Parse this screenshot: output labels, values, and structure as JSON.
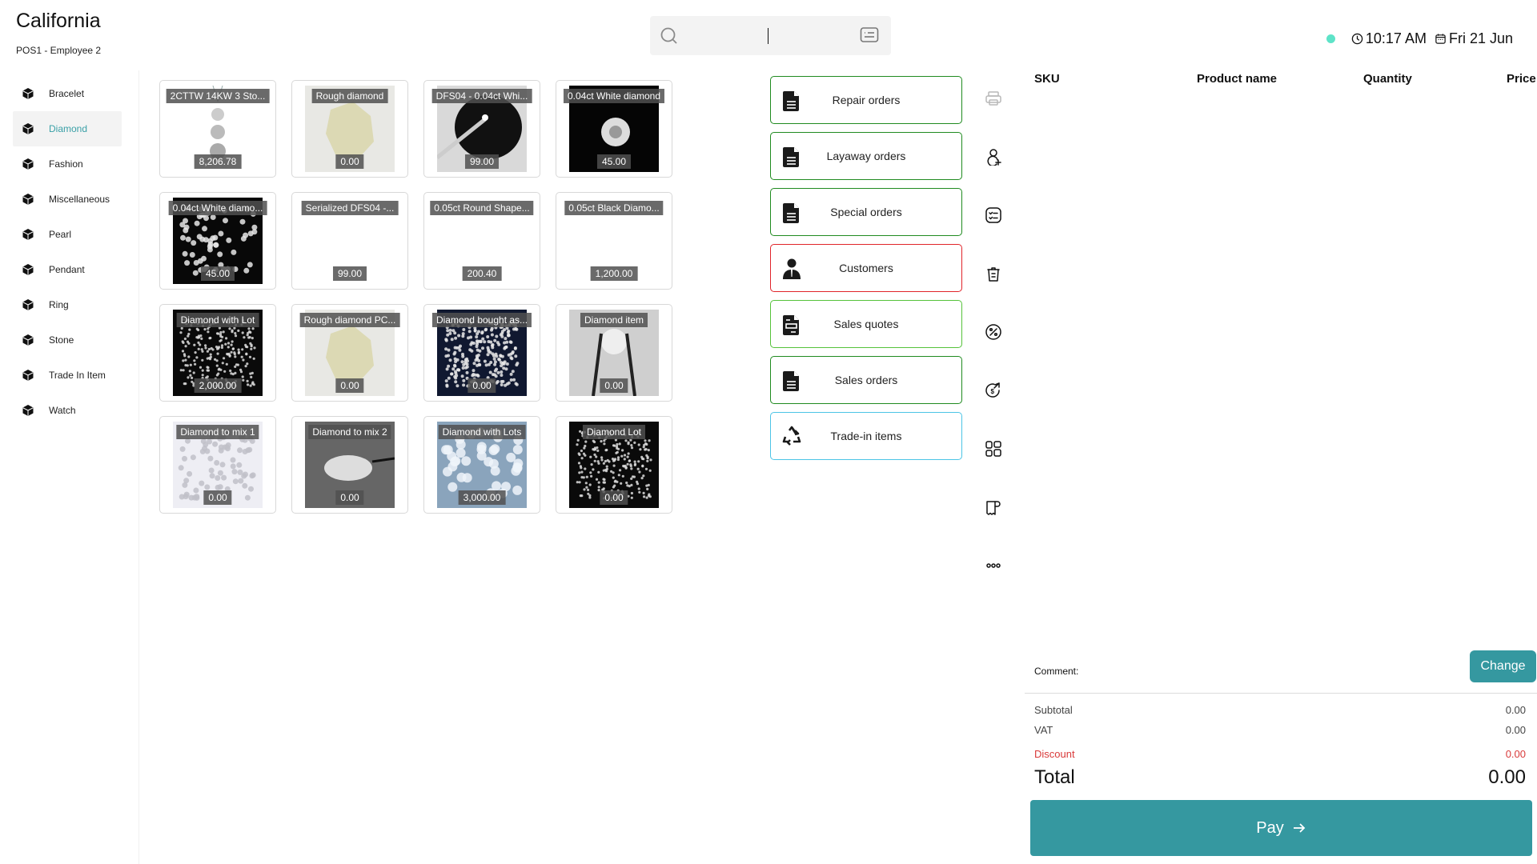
{
  "header": {
    "store": "California",
    "station": "POS1 - Employee 2",
    "search": {
      "value": "",
      "placeholder": ""
    },
    "status": {
      "online_color": "#5ee3c8",
      "time": "10:17 AM",
      "date": "Fri 21 Jun"
    }
  },
  "sidebar": {
    "active": "Diamond",
    "items": [
      {
        "label": "Bracelet"
      },
      {
        "label": "Diamond"
      },
      {
        "label": "Fashion"
      },
      {
        "label": "Miscellaneous"
      },
      {
        "label": "Pearl"
      },
      {
        "label": "Pendant"
      },
      {
        "label": "Ring"
      },
      {
        "label": "Stone"
      },
      {
        "label": "Trade In Item"
      },
      {
        "label": "Watch"
      }
    ]
  },
  "products": [
    {
      "name": "2CTTW 14KW 3 Sto...",
      "price": "8,206.78",
      "image": "pendant"
    },
    {
      "name": "Rough diamond",
      "price": "0.00",
      "image": "rough"
    },
    {
      "name": "DFS04 - 0.04ct  Whi...",
      "price": "99.00",
      "image": "tweezer"
    },
    {
      "name": "0.04ct White diamond",
      "price": "45.00",
      "image": "brilliant"
    },
    {
      "name": "0.04ct White diamo...",
      "price": "45.00",
      "image": "scatter-dark"
    },
    {
      "name": "Serialized DFS04 -...",
      "price": "99.00",
      "image": "none"
    },
    {
      "name": "0.05ct Round Shape...",
      "price": "200.40",
      "image": "none"
    },
    {
      "name": "0.05ct Black Diamo...",
      "price": "1,200.00",
      "image": "none"
    },
    {
      "name": "Diamond with Lot",
      "price": "2,000.00",
      "image": "lot-dark"
    },
    {
      "name": "Rough diamond PC...",
      "price": "0.00",
      "image": "rough"
    },
    {
      "name": "Diamond bought as...",
      "price": "0.00",
      "image": "lot-navy"
    },
    {
      "name": "Diamond item",
      "price": "0.00",
      "image": "tweezer-gray"
    },
    {
      "name": "Diamond to mix 1",
      "price": "0.00",
      "image": "scatter-light"
    },
    {
      "name": "Diamond to mix 2",
      "price": "0.00",
      "image": "pile-gray"
    },
    {
      "name": "Diamond with Lots",
      "price": "3,000.00",
      "image": "blue-pile"
    },
    {
      "name": "Diamond Lot",
      "price": "0.00",
      "image": "lot-dark"
    }
  ],
  "actions": [
    {
      "label": "Repair orders",
      "icon": "document-icon",
      "border": "#1f8a1f"
    },
    {
      "label": "Layaway orders",
      "icon": "document-icon",
      "border": "#1f8a1f"
    },
    {
      "label": "Special orders",
      "icon": "document-icon",
      "border": "#1f8a1f"
    },
    {
      "label": "Customers",
      "icon": "customer-icon",
      "border": "#e0242a"
    },
    {
      "label": "Sales quotes",
      "icon": "quote-document-icon",
      "border": "#55c23a"
    },
    {
      "label": "Sales orders",
      "icon": "document-icon",
      "border": "#1f8a1f"
    },
    {
      "label": "Trade-in items",
      "icon": "recycle-icon",
      "border": "#4cc4e6"
    }
  ],
  "toolbar": [
    {
      "name": "print-icon",
      "disabled": true
    },
    {
      "name": "add-customer-icon",
      "disabled": false
    },
    {
      "name": "checklist-icon",
      "disabled": false
    },
    {
      "name": "trash-icon",
      "disabled": false
    },
    {
      "name": "discount-icon",
      "disabled": false
    },
    {
      "name": "cash-out-icon",
      "disabled": false
    },
    {
      "name": "apps-grid-icon",
      "disabled": false
    },
    {
      "name": "receipt-icon",
      "disabled": false
    },
    {
      "name": "more-icon",
      "disabled": false
    }
  ],
  "cart": {
    "columns": {
      "sku": "SKU",
      "product": "Product name",
      "quantity": "Quantity",
      "price": "Price"
    },
    "rows": [],
    "comment_label": "Comment:",
    "change_label": "Change",
    "subtotal_label": "Subtotal",
    "subtotal": "0.00",
    "vat_label": "VAT",
    "vat": "0.00",
    "discount_label": "Discount",
    "discount": "0.00",
    "total_label": "Total",
    "total": "0.00",
    "pay_label": "Pay",
    "accent_color": "#3598a0",
    "discount_color": "#d93a3a"
  }
}
